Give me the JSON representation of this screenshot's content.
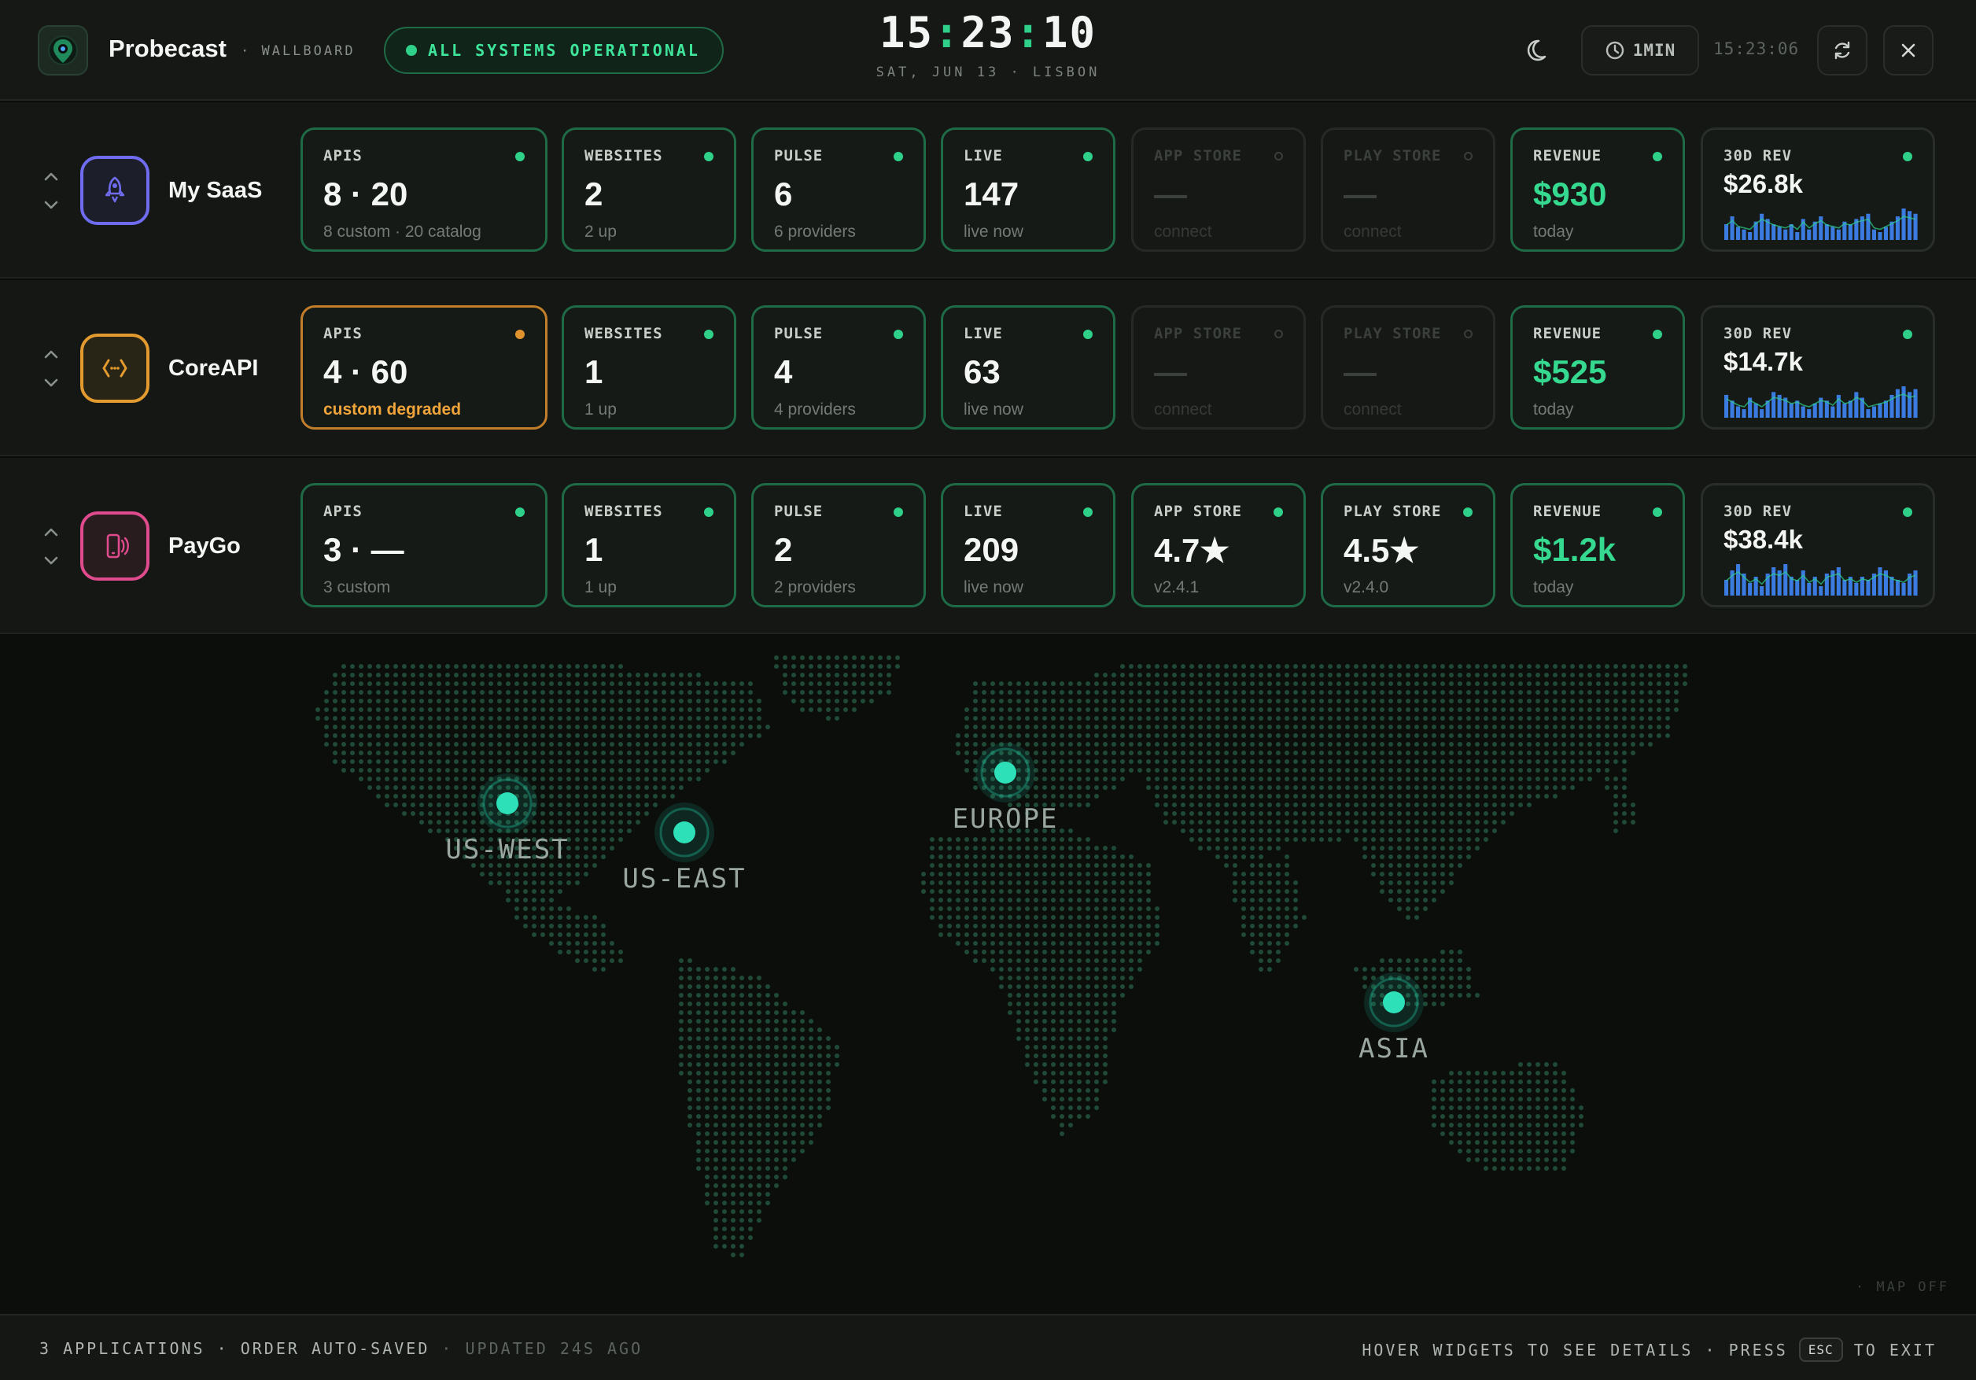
{
  "header": {
    "brand": "Probecast",
    "subtitle": "· WALLBOARD",
    "status": "ALL SYSTEMS OPERATIONAL",
    "clock": {
      "h": "15",
      "m": "23",
      "s": "10"
    },
    "date": "SAT, JUN 13 · LISBON",
    "refresh_interval": "1MIN",
    "last_refresh": "15:23:06",
    "colors": {
      "accent": "#2fd08a",
      "warn": "#e0922f"
    },
    "icons": [
      "logo-icon",
      "moon-icon",
      "clock-icon",
      "refresh-icon",
      "close-icon"
    ]
  },
  "apps": [
    {
      "name": "My SaaS",
      "icon": "rocket-icon",
      "icon_color": "#6f6cf0",
      "widgets": {
        "apis": {
          "label": "APIS",
          "value": "8 · 20",
          "sub": "8 custom · 20 catalog",
          "status": "ok"
        },
        "websites": {
          "label": "WEBSITES",
          "value": "2",
          "sub": "2 up",
          "status": "ok"
        },
        "pulse": {
          "label": "PULSE",
          "value": "6",
          "sub": "6 providers",
          "status": "ok"
        },
        "live": {
          "label": "LIVE",
          "value": "147",
          "sub": "live now",
          "status": "ok"
        },
        "app_store": {
          "label": "APP STORE",
          "value": "—",
          "sub": "connect",
          "status": "off"
        },
        "play_store": {
          "label": "PLAY STORE",
          "value": "—",
          "sub": "connect",
          "status": "off"
        },
        "revenue": {
          "label": "REVENUE",
          "value": "$930",
          "sub": "today",
          "status": "ok"
        },
        "rev30": {
          "label": "30D REV",
          "value": "$26.8k",
          "status": "ok",
          "series": [
            6,
            9,
            5,
            4,
            3,
            7,
            10,
            8,
            6,
            5,
            4,
            6,
            3,
            8,
            4,
            7,
            9,
            6,
            5,
            4,
            7,
            6,
            8,
            9,
            10,
            4,
            3,
            5,
            7,
            9,
            12,
            11,
            10
          ]
        }
      }
    },
    {
      "name": "CoreAPI",
      "icon": "code-icon",
      "icon_color": "#e39a2e",
      "widgets": {
        "apis": {
          "label": "APIS",
          "value": "4 · 60",
          "sub": "custom degraded",
          "status": "warn"
        },
        "websites": {
          "label": "WEBSITES",
          "value": "1",
          "sub": "1 up",
          "status": "ok"
        },
        "pulse": {
          "label": "PULSE",
          "value": "4",
          "sub": "4 providers",
          "status": "ok"
        },
        "live": {
          "label": "LIVE",
          "value": "63",
          "sub": "live now",
          "status": "ok"
        },
        "app_store": {
          "label": "APP STORE",
          "value": "—",
          "sub": "connect",
          "status": "off"
        },
        "play_store": {
          "label": "PLAY STORE",
          "value": "—",
          "sub": "connect",
          "status": "off"
        },
        "revenue": {
          "label": "REVENUE",
          "value": "$525",
          "sub": "today",
          "status": "ok"
        },
        "rev30": {
          "label": "30D REV",
          "value": "$14.7k",
          "status": "ok",
          "series": [
            8,
            6,
            4,
            3,
            7,
            5,
            3,
            6,
            9,
            8,
            7,
            5,
            6,
            4,
            3,
            5,
            7,
            6,
            4,
            8,
            5,
            6,
            9,
            7,
            3,
            4,
            5,
            6,
            8,
            10,
            11,
            9,
            10
          ]
        }
      }
    },
    {
      "name": "PayGo",
      "icon": "phone-signal-icon",
      "icon_color": "#e04b8e",
      "widgets": {
        "apis": {
          "label": "APIS",
          "value": "3 · —",
          "sub": "3 custom",
          "status": "ok"
        },
        "websites": {
          "label": "WEBSITES",
          "value": "1",
          "sub": "1 up",
          "status": "ok"
        },
        "pulse": {
          "label": "PULSE",
          "value": "2",
          "sub": "2 providers",
          "status": "ok"
        },
        "live": {
          "label": "LIVE",
          "value": "209",
          "sub": "live now",
          "status": "ok"
        },
        "app_store": {
          "label": "APP STORE",
          "value": "4.7★",
          "sub": "v2.4.1",
          "status": "ok"
        },
        "play_store": {
          "label": "PLAY STORE",
          "value": "4.5★",
          "sub": "v2.4.0",
          "status": "ok"
        },
        "revenue": {
          "label": "REVENUE",
          "value": "$1.2k",
          "sub": "today",
          "status": "ok"
        },
        "rev30": {
          "label": "30D REV",
          "value": "$38.4k",
          "status": "ok",
          "series": [
            5,
            8,
            10,
            7,
            4,
            6,
            3,
            7,
            9,
            8,
            10,
            6,
            5,
            8,
            4,
            6,
            3,
            7,
            8,
            9,
            5,
            6,
            4,
            6,
            5,
            7,
            9,
            8,
            6,
            5,
            4,
            7,
            8
          ]
        }
      }
    }
  ],
  "map": {
    "regions": [
      {
        "name": "US-WEST"
      },
      {
        "name": "US-EAST"
      },
      {
        "name": "EUROPE"
      },
      {
        "name": "ASIA"
      }
    ],
    "map_toggle": "· MAP OFF"
  },
  "footer": {
    "summary": "3 APPLICATIONS · ORDER AUTO-SAVED",
    "updated": "· UPDATED 24S AGO",
    "hint": "HOVER WIDGETS TO SEE DETAILS · PRESS",
    "key": "ESC",
    "hint_end": "TO EXIT"
  }
}
